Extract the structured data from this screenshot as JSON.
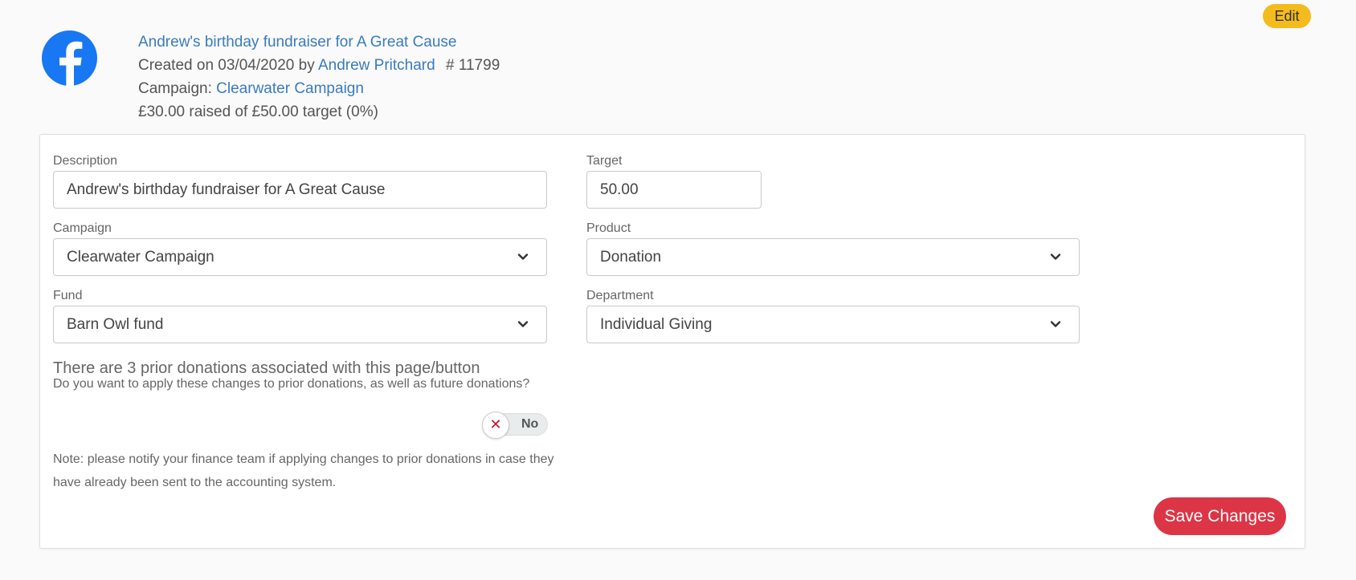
{
  "header": {
    "edit_label": "Edit",
    "page_title": "Andrew's birthday fundraiser for A Great Cause",
    "created_prefix": "Created on 03/04/2020 by",
    "creator": "Andrew Pritchard",
    "page_number": "# 11799",
    "campaign_prefix": "Campaign:",
    "campaign_link": "Clearwater Campaign",
    "progress_text": "£30.00 raised of £50.00 target (0%)",
    "logo_icon": "facebook-icon",
    "brand_color": "#1877f2"
  },
  "form": {
    "description": {
      "label": "Description",
      "value": "Andrew's birthday fundraiser for A Great Cause"
    },
    "target": {
      "label": "Target",
      "value": "50.00"
    },
    "campaign": {
      "label": "Campaign",
      "value": "Clearwater Campaign"
    },
    "product": {
      "label": "Product",
      "value": "Donation"
    },
    "fund": {
      "label": "Fund",
      "value": "Barn Owl fund"
    },
    "department": {
      "label": "Department",
      "value": "Individual Giving"
    },
    "prior_title": "There are 3 prior donations associated with this page/button",
    "prior_question": "Do you want to apply these changes to prior donations, as well as future donations?",
    "toggle": {
      "state": "No",
      "icon": "x-icon"
    },
    "note": "Note: please notify your finance team if applying changes to prior donations in case they have already been sent to the accounting system.",
    "save_label": "Save Changes",
    "save_color": "#dc3545"
  }
}
